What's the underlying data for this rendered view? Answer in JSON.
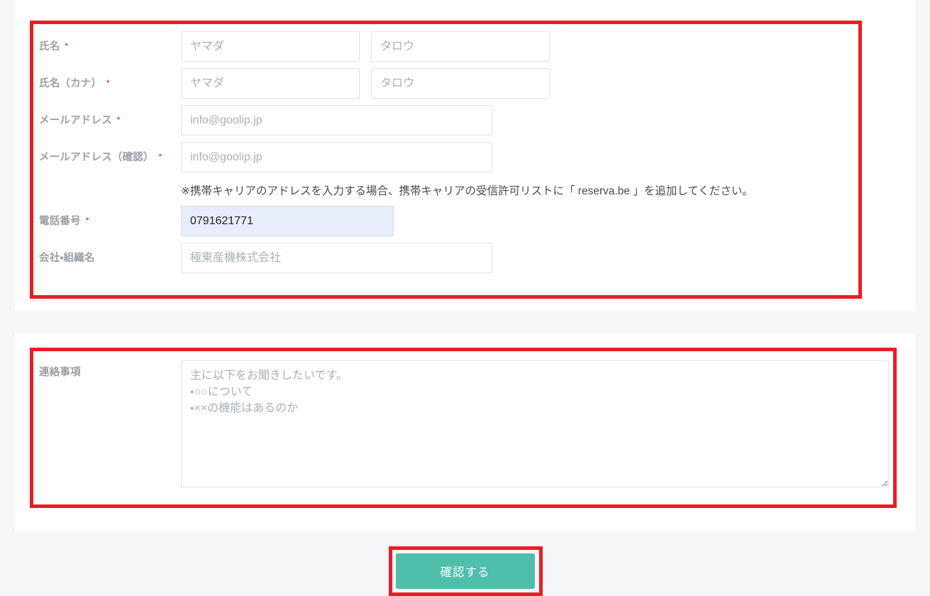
{
  "colors": {
    "page_background": "#f5f6f8",
    "card_background": "#ffffff",
    "annotation_red": "#ec1c24",
    "label_gray": "#9aa0a6",
    "required_red": "#e8443a",
    "input_border": "#dfe3e8",
    "placeholder_gray": "#a9b0b8",
    "autofill_background": "#e8edfb",
    "submit_teal": "#4dbfab"
  },
  "personal_section": {
    "rows": [
      {
        "label": "氏名",
        "required_mark": "*",
        "fields": [
          {
            "name": "last-name",
            "placeholder": "ヤマダ",
            "value": ""
          },
          {
            "name": "first-name",
            "placeholder": "タロウ",
            "value": ""
          }
        ]
      },
      {
        "label": "氏名（カナ）",
        "required_mark": "*",
        "fields": [
          {
            "name": "last-name-kana",
            "placeholder": "ヤマダ",
            "value": ""
          },
          {
            "name": "first-name-kana",
            "placeholder": "タロウ",
            "value": ""
          }
        ]
      },
      {
        "label": "メールアドレス",
        "required_mark": "*",
        "fields": [
          {
            "name": "email",
            "placeholder": "info@goolip.jp",
            "value": ""
          }
        ]
      },
      {
        "label": "メールアドレス（確認）",
        "required_mark": "*",
        "fields": [
          {
            "name": "email-confirm",
            "placeholder": "info@goolip.jp",
            "value": ""
          }
        ]
      },
      {
        "label": "電話番号",
        "required_mark": "*",
        "fields": [
          {
            "name": "phone",
            "placeholder": "",
            "value": "0791621771"
          }
        ]
      },
      {
        "label": "会社・組織名",
        "required_mark": "",
        "fields": [
          {
            "name": "company",
            "placeholder": "極東産機株式会社",
            "value": ""
          }
        ]
      }
    ],
    "email_note": "※携帯キャリアのアドレスを入力する場合、携帯キャリアの受信許可リストに「 reserva.be 」を追加してください。"
  },
  "message_section": {
    "label": "連絡事項",
    "placeholder": "主に以下をお聞きしたいです。\n・○○について\n・××の機能はあるのか",
    "value": ""
  },
  "submit": {
    "label": "確認する"
  }
}
